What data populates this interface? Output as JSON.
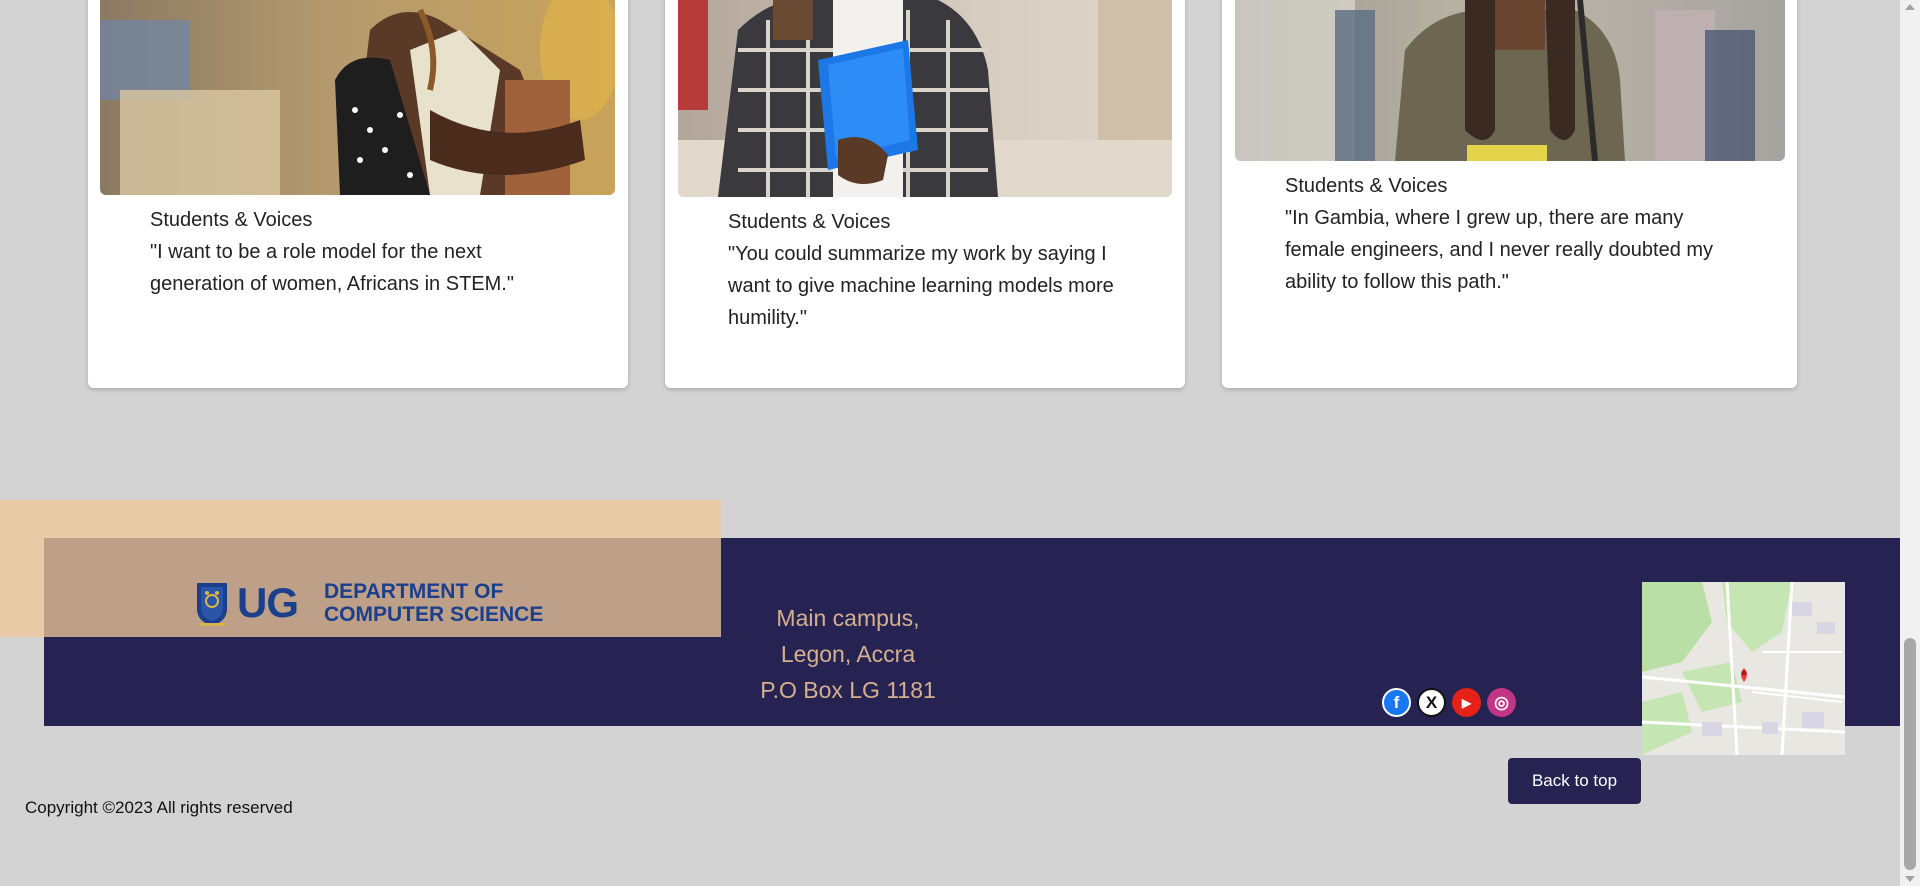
{
  "cards": [
    {
      "category": "Students & Voices",
      "quote": "\"I want to be a role model for the next generation of women, Africans in STEM.\""
    },
    {
      "category": "Students & Voices",
      "quote": "\"You could summarize my work by saying I want to give machine learning models more humility.\""
    },
    {
      "category": "Students & Voices",
      "quote": "\"In Gambia, where I grew up, there are many female engineers, and I never really doubted my ability to follow this path.\""
    }
  ],
  "footer": {
    "logo": {
      "short": "UG",
      "line1": "DEPARTMENT OF",
      "line2": "COMPUTER SCIENCE"
    },
    "address": [
      "Main campus,",
      "Legon, Accra",
      "P.O Box LG 1181"
    ],
    "social": [
      {
        "name": "facebook-icon",
        "glyph": "f",
        "color": "#1877f2"
      },
      {
        "name": "x-twitter-icon",
        "glyph": "X",
        "color": "#111111"
      },
      {
        "name": "youtube-icon",
        "glyph": "▶",
        "color": "#e62117"
      },
      {
        "name": "instagram-icon",
        "glyph": "◎",
        "color": "#c13584"
      }
    ],
    "back_to_top": "Back to top",
    "copyright": "Copyright ©2023 All rights reserved"
  },
  "colors": {
    "background": "#d3d3d3",
    "footer_band": "#262353",
    "footer_accent": "#e8caa6",
    "logo_box": "#bea088",
    "address_text": "#d4b08f",
    "logo_blue": "#1b3f8b"
  }
}
